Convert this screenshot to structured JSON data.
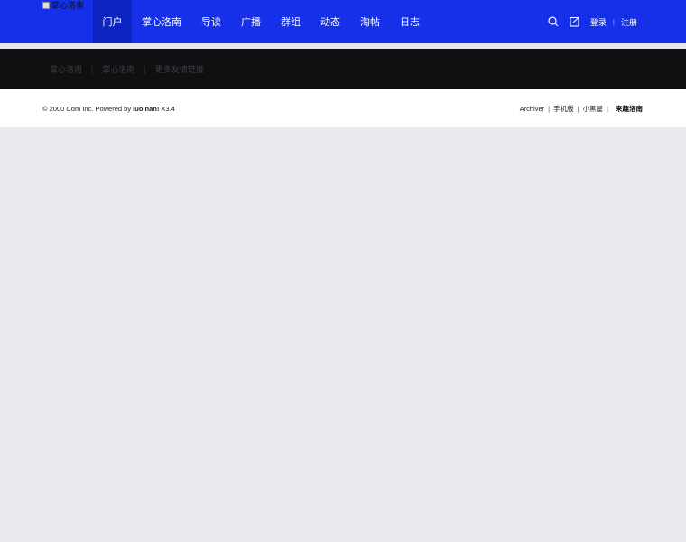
{
  "header": {
    "logo_alt": "掌心洛南",
    "nav": [
      {
        "label": "门户",
        "active": true
      },
      {
        "label": "掌心洛南"
      },
      {
        "label": "导读"
      },
      {
        "label": "广播"
      },
      {
        "label": "群组"
      },
      {
        "label": "动态"
      },
      {
        "label": "淘帖"
      },
      {
        "label": "日志"
      }
    ],
    "login": "登录",
    "register": "注册",
    "icons": [
      "search-icon",
      "edit-note-icon"
    ]
  },
  "links_band": {
    "items": [
      "掌心洛南",
      "掌心洛南",
      "更多友情链接"
    ]
  },
  "footer": {
    "copyright_prefix": "© 2000 Com Inc. Powered by ",
    "powered_brand": "luo nan!",
    "version": " X3.4",
    "links": [
      "Archiver",
      "手机版",
      "小黑屋"
    ],
    "brand_link": "来趣洛南"
  },
  "colors": {
    "header_bg": "#1530e8",
    "nav_active_bg": "#0e24c0",
    "links_band_bg": "#0f1012",
    "page_bg": "#e8eaed"
  }
}
